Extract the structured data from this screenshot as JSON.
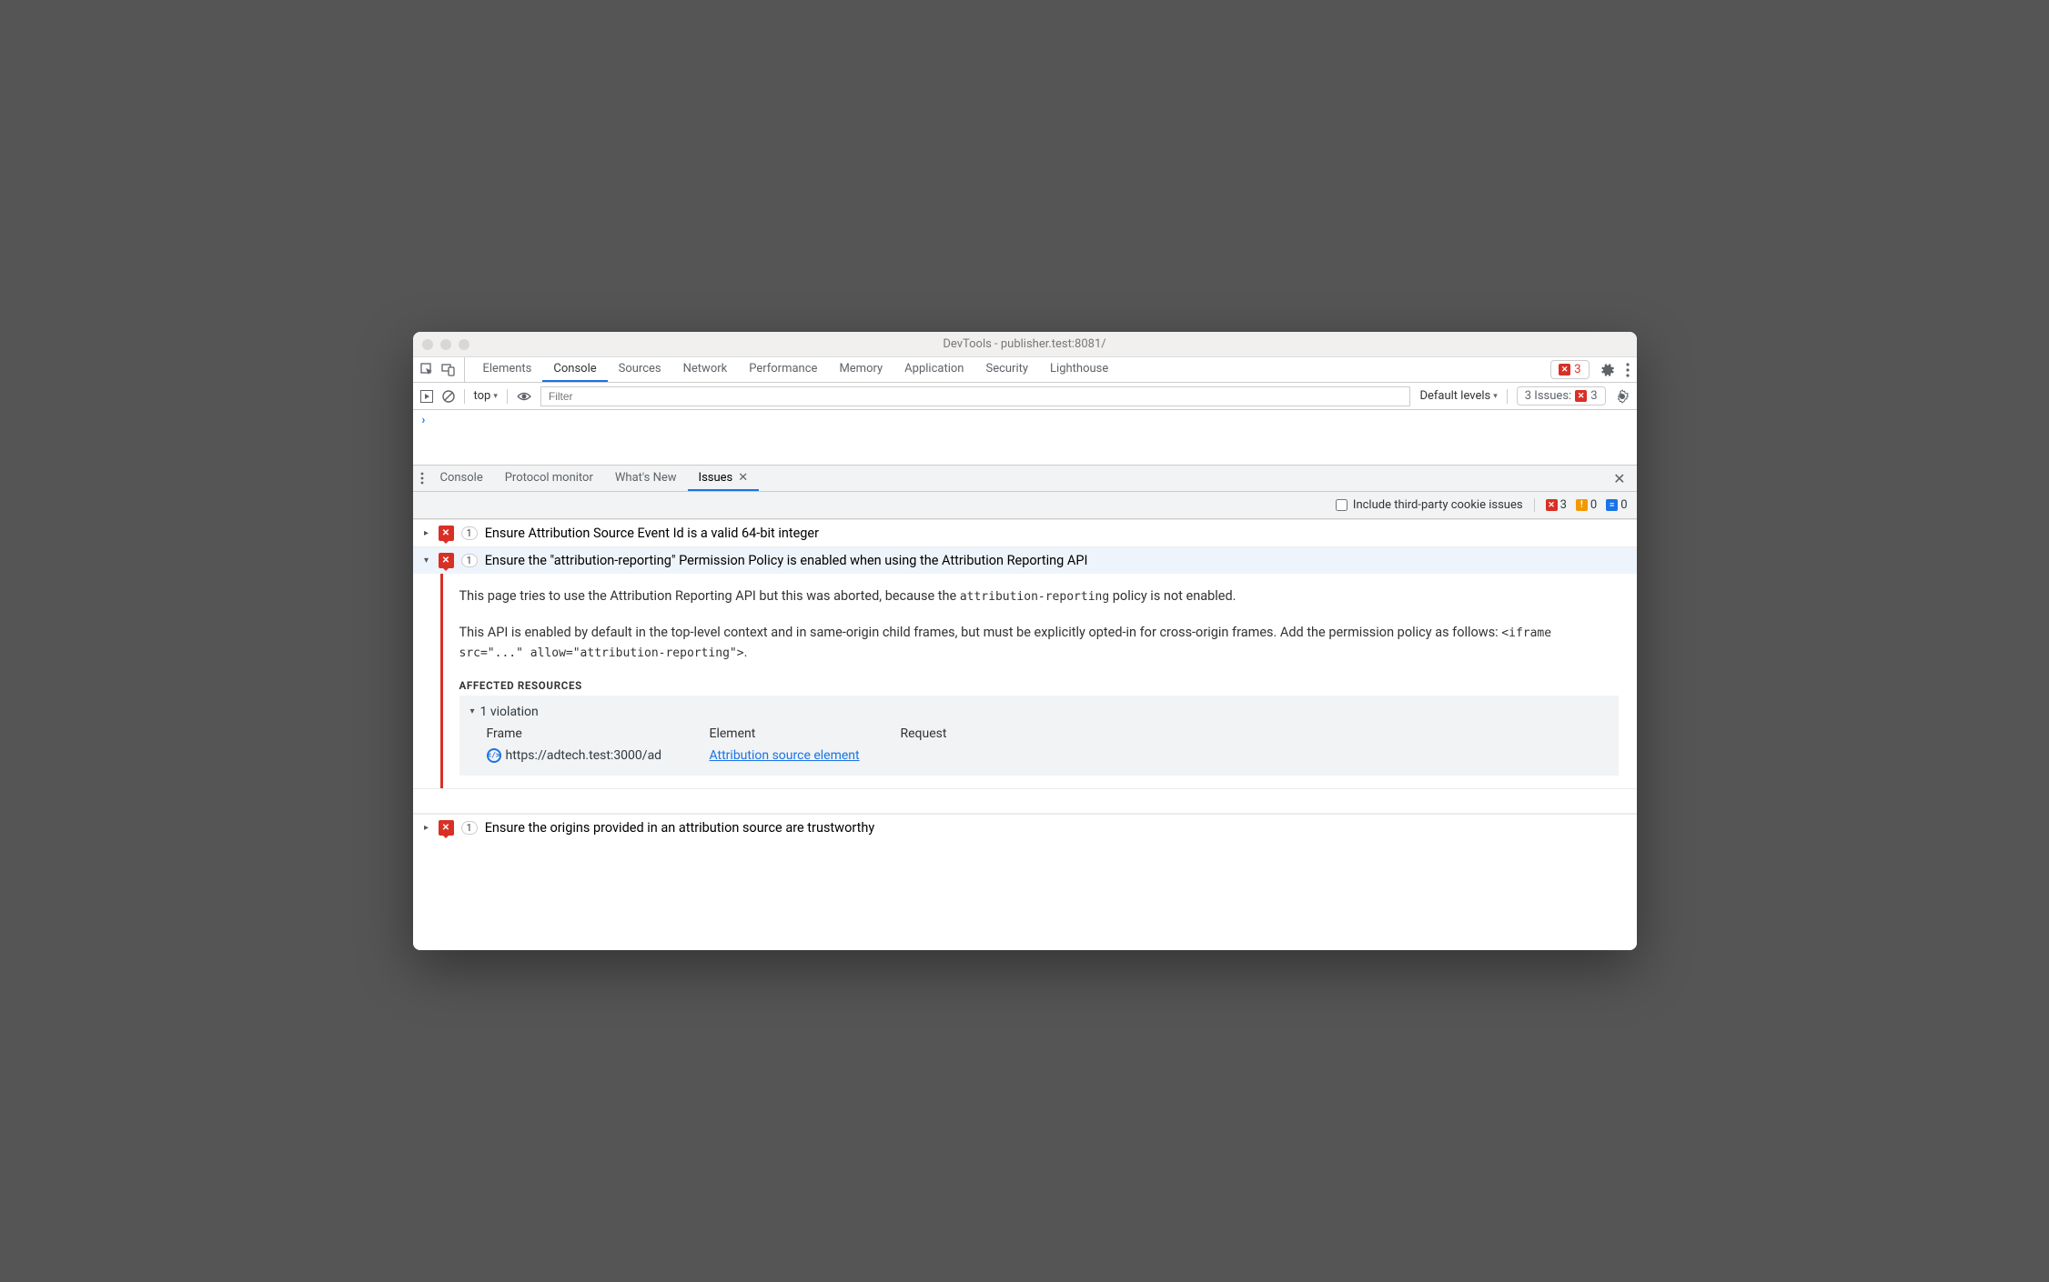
{
  "window_title": "DevTools - publisher.test:8081/",
  "main_tabs": [
    "Elements",
    "Console",
    "Sources",
    "Network",
    "Performance",
    "Memory",
    "Application",
    "Security",
    "Lighthouse"
  ],
  "main_active": "Console",
  "top_error_count": "3",
  "console": {
    "context": "top",
    "filter_placeholder": "Filter",
    "levels": "Default levels",
    "issues_label": "3 Issues:",
    "issues_count": "3",
    "prompt": "›"
  },
  "drawer_tabs": [
    "Console",
    "Protocol monitor",
    "What's New",
    "Issues"
  ],
  "drawer_active": "Issues",
  "issues_bar": {
    "checkbox_label": "Include third-party cookie issues",
    "red": "3",
    "yellow": "0",
    "blue": "0"
  },
  "issue0": {
    "count": "1",
    "title": "Ensure Attribution Source Event Id is a valid 64-bit integer"
  },
  "issue1": {
    "count": "1",
    "title": "Ensure the \"attribution-reporting\" Permission Policy is enabled when using the Attribution Reporting API",
    "p1a": "This page tries to use the Attribution Reporting API but this was aborted, because the ",
    "p1code": "attribution-reporting",
    "p1b": " policy is not enabled.",
    "p2a": "This API is enabled by default in the top-level context and in same-origin child frames, but must be explicitly opted-in for cross-origin frames. Add the permission policy as follows: ",
    "p2code": "<iframe src=\"...\" allow=\"attribution-reporting\">",
    "p2b": ".",
    "affected_heading": "AFFECTED RESOURCES",
    "violation_label": "1 violation",
    "th_frame": "Frame",
    "th_element": "Element",
    "th_request": "Request",
    "frame_url": "https://adtech.test:3000/ad",
    "element_link": "Attribution source element"
  },
  "issue2": {
    "count": "1",
    "title": "Ensure the origins provided in an attribution source are trustworthy"
  }
}
